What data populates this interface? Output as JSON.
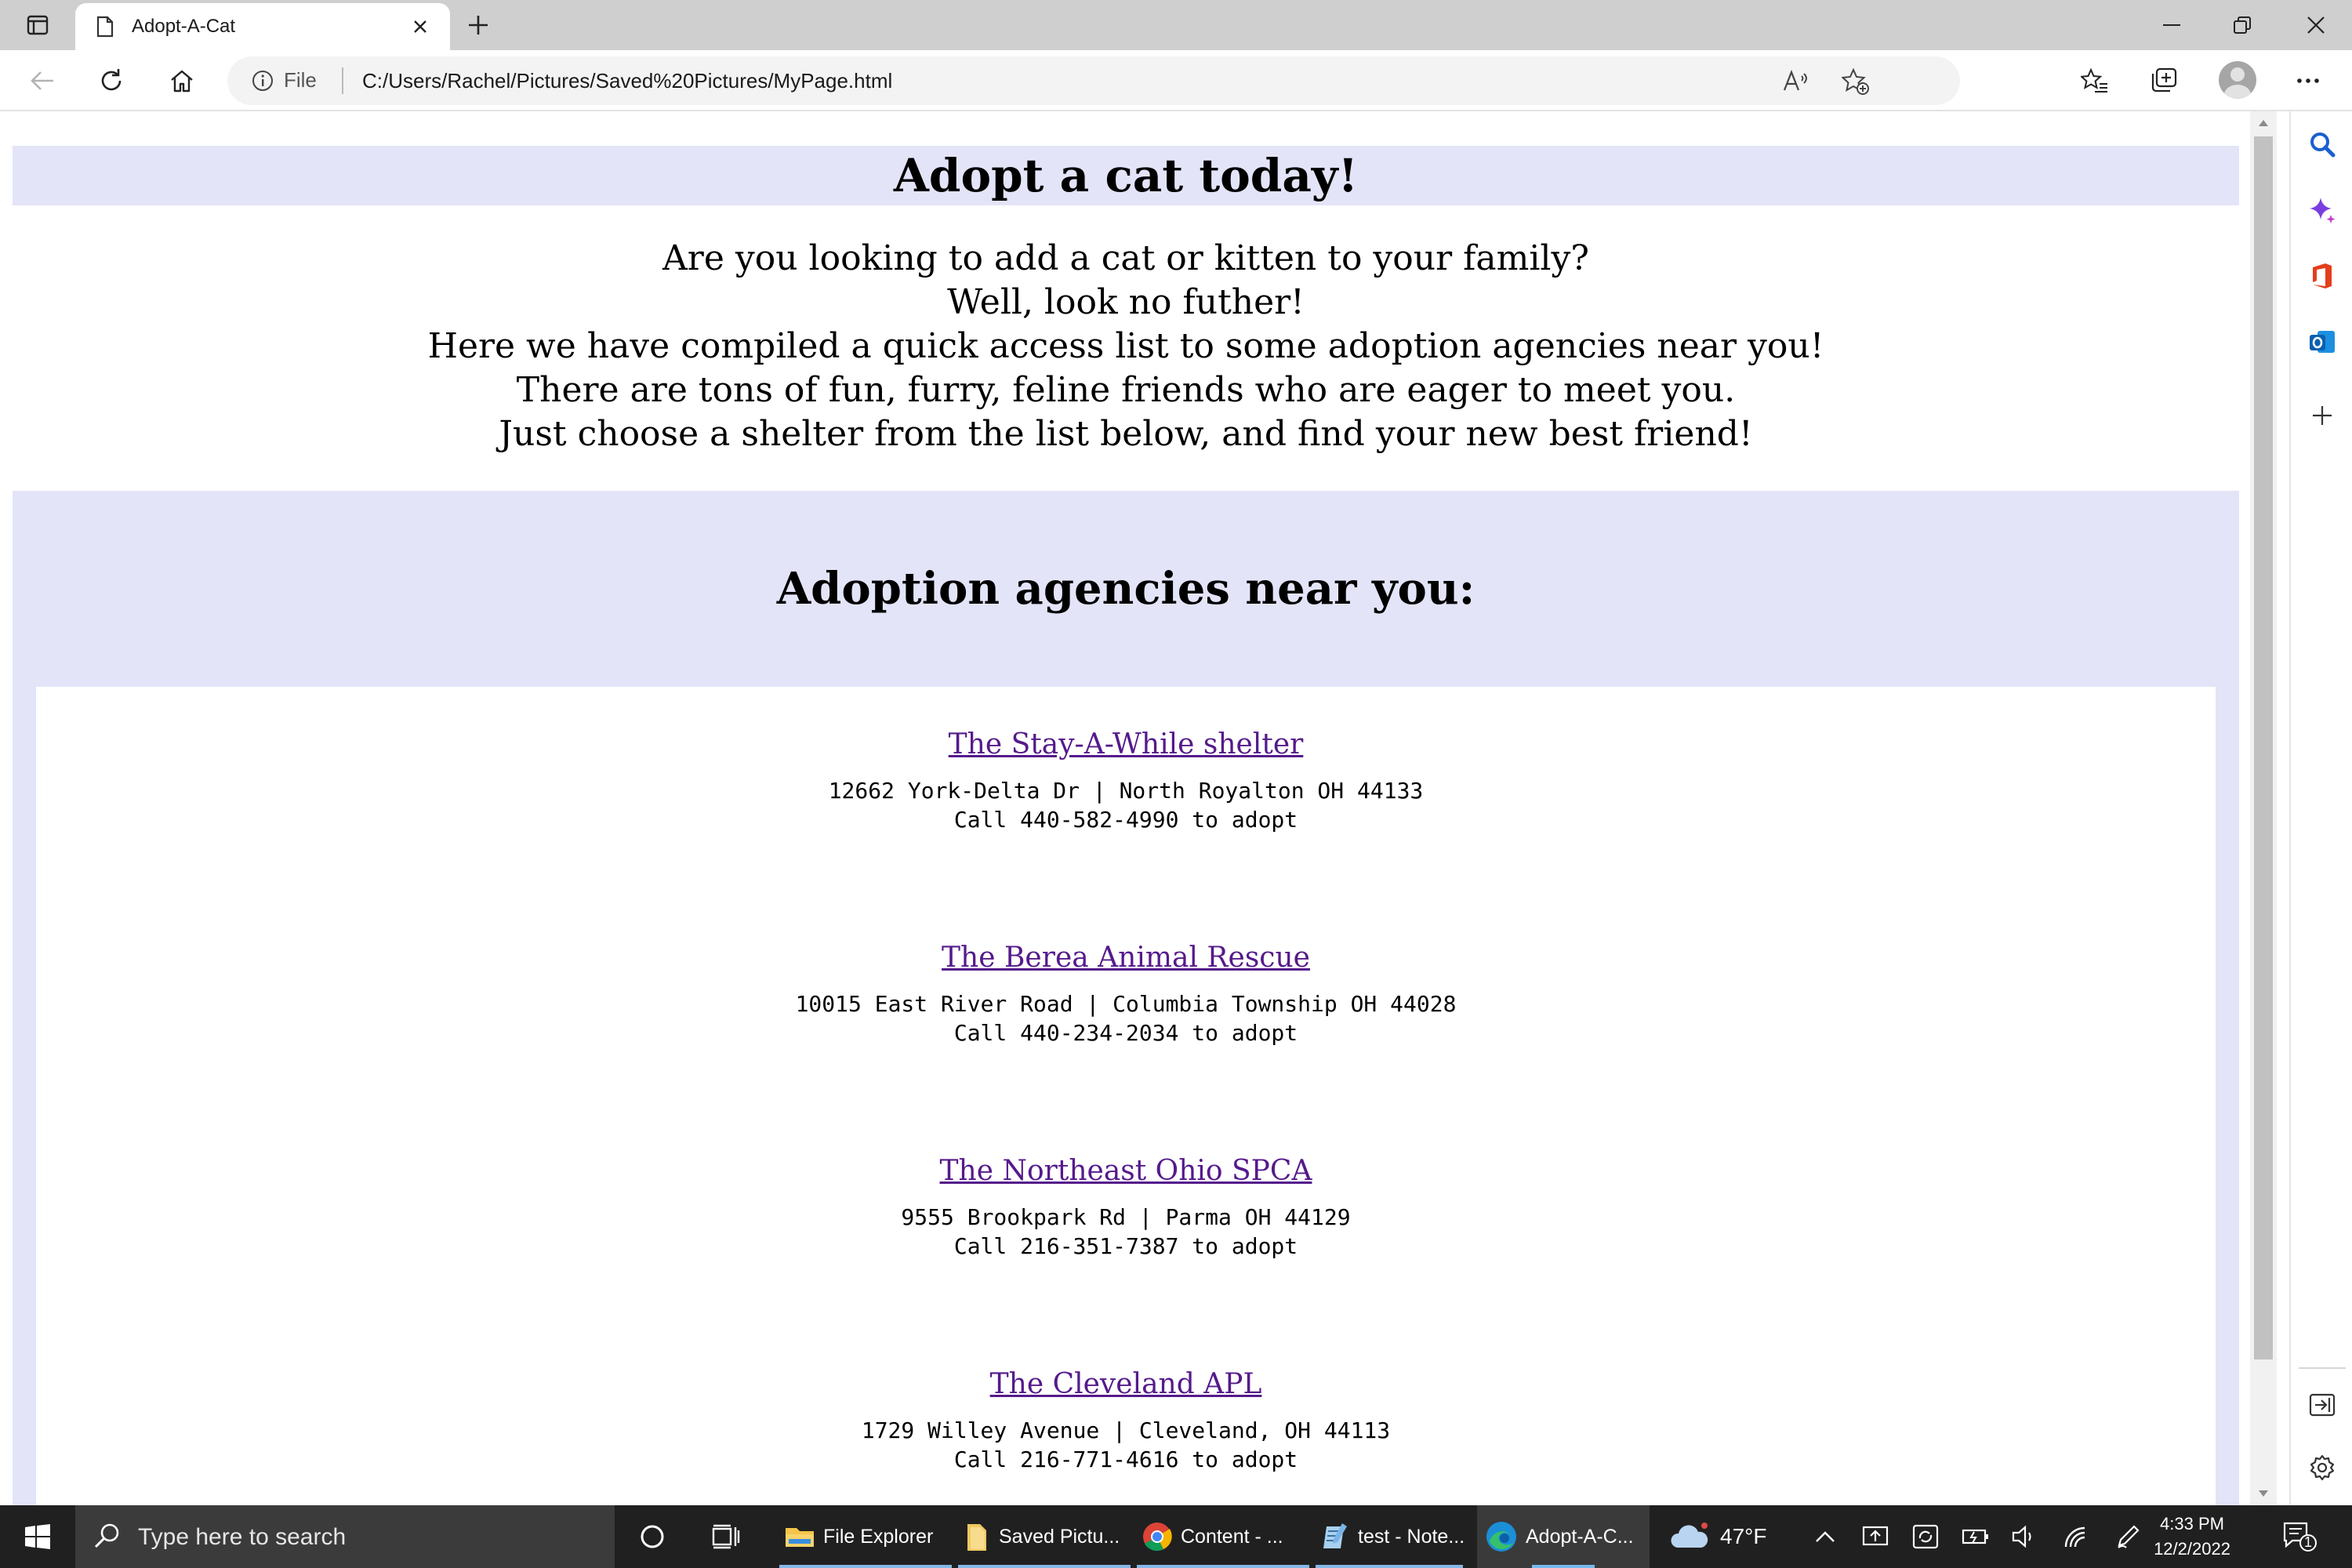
{
  "browser": {
    "tab_title": "Adopt-A-Cat",
    "site_info_label": "File",
    "url": "C:/Users/Rachel/Pictures/Saved%20Pictures/MyPage.html"
  },
  "page": {
    "title": "Adopt a cat today!",
    "intro_lines": [
      "Are you looking to add a cat or kitten to your family?",
      "Well, look no futher!",
      "Here we have compiled a quick access list to some adoption agencies near you!",
      "There are tons of fun, furry, feline friends who are eager to meet you.",
      "Just choose a shelter from the list below, and find your new best friend!"
    ],
    "agencies_heading": "Adoption agencies near you:",
    "agencies": [
      {
        "name": "The Stay-A-While shelter",
        "address": "12662 York-Delta Dr | North Royalton OH 44133",
        "call": "Call 440-582-4990 to adopt"
      },
      {
        "name": "The Berea Animal Rescue",
        "address": "10015 East River Road | Columbia Township OH 44028",
        "call": "Call 440-234-2034 to adopt"
      },
      {
        "name": "The Northeast Ohio SPCA",
        "address": "9555 Brookpark Rd | Parma OH 44129",
        "call": "Call 216-351-7387 to adopt"
      },
      {
        "name": "The Cleveland APL",
        "address": "1729 Willey Avenue | Cleveland, OH 44113",
        "call": "Call 216-771-4616 to adopt"
      }
    ]
  },
  "taskbar": {
    "search_placeholder": "Type here to search",
    "apps": [
      {
        "label": "File Explorer",
        "icon": "folder-icon"
      },
      {
        "label": "Saved Pictu...",
        "icon": "folder-icon"
      },
      {
        "label": "Content - ...",
        "icon": "chrome-icon"
      },
      {
        "label": "test - Note...",
        "icon": "notepad-icon"
      },
      {
        "label": "Adopt-A-C...",
        "icon": "edge-icon"
      }
    ],
    "weather_temp": "47°F",
    "time": "4:33 PM",
    "date": "12/2/2022",
    "notification_count": "1"
  },
  "colors": {
    "band_lavender": "#e3e4f8",
    "visited_link": "#551a8b",
    "taskbar_bg": "#202020"
  }
}
